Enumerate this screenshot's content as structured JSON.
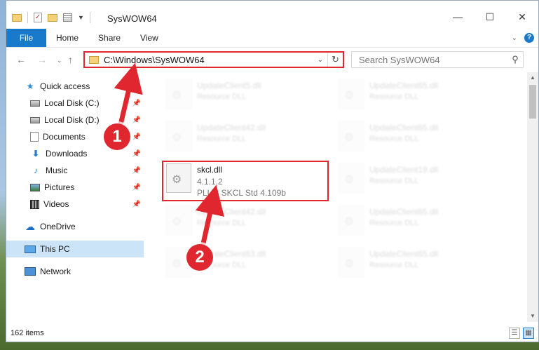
{
  "window": {
    "title": "SysWOW64",
    "minimize_icon": "minimize-icon",
    "maximize_icon": "maximize-icon",
    "close_icon": "close-icon"
  },
  "ribbon": {
    "tabs": [
      "File",
      "Home",
      "Share",
      "View"
    ],
    "help_label": "?"
  },
  "address_bar": {
    "path": "C:\\Windows\\SysWOW64",
    "search_placeholder": "Search SysWOW64"
  },
  "sidebar": {
    "quick_access": "Quick access",
    "items": [
      {
        "label": "Local Disk (C:)",
        "icon": "disk-icon"
      },
      {
        "label": "Local Disk (D:)",
        "icon": "disk-icon"
      },
      {
        "label": "Documents",
        "icon": "documents-icon"
      },
      {
        "label": "Downloads",
        "icon": "downloads-icon"
      },
      {
        "label": "Music",
        "icon": "music-icon"
      },
      {
        "label": "Pictures",
        "icon": "pictures-icon"
      },
      {
        "label": "Videos",
        "icon": "videos-icon"
      }
    ],
    "onedrive": "OneDrive",
    "this_pc": "This PC",
    "network": "Network"
  },
  "files": {
    "left": [
      {
        "name": "UpdateClient5.dll",
        "desc": "Resource DLL"
      },
      {
        "name": "UpdateClient42.dll",
        "desc": "Resource DLL"
      },
      {
        "name": "UpdateClient42.dll",
        "desc": "Resource DLL"
      },
      {
        "name": "UpdateClient63.dll",
        "desc": "Resource DLL"
      }
    ],
    "right": [
      {
        "name": "UpdateClient65.dll",
        "desc": "Resource DLL"
      },
      {
        "name": "UpdateClient65.dll",
        "desc": "Resource DLL"
      },
      {
        "name": "UpdateClient19.dll",
        "desc": "Resource DLL"
      },
      {
        "name": "UpdateClient65.dll",
        "desc": "Resource DLL"
      },
      {
        "name": "UpdateClient65.dll",
        "desc": "Resource DLL"
      }
    ],
    "highlighted": {
      "name": "skcl.dll",
      "version": "4.1.1.2",
      "description": "PLUS SKCL Std 4.109b"
    }
  },
  "status": {
    "item_count": "162 items"
  },
  "annotations": {
    "step1": "1",
    "step2": "2",
    "accent_color": "#e0262e"
  }
}
